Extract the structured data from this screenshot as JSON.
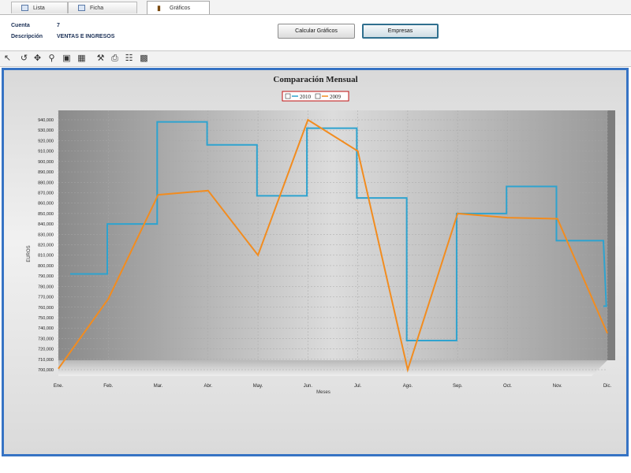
{
  "tabs": [
    {
      "label": "Lista"
    },
    {
      "label": "Ficha"
    },
    {
      "label": "Gráficos"
    }
  ],
  "info": {
    "cuenta_label": "Cuenta",
    "cuenta_value": "7",
    "descripcion_label": "Descripción",
    "descripcion_value": "VENTAS E INGRESOS"
  },
  "buttons": {
    "calcular": "Calcular Gráficos",
    "empresas": "Empresas"
  },
  "toolbar_icons": [
    "pointer-icon",
    "rotate-icon",
    "move-icon",
    "zoom-icon",
    "copy-icon",
    "export-icon",
    "settings-icon",
    "print-icon",
    "clipboard-icon",
    "save-icon"
  ],
  "colors": {
    "series_2010": "#2ea3cf",
    "series_2009": "#f28c1f",
    "panel_border": "#3673c4"
  },
  "chart_data": {
    "type": "line",
    "title": "Comparación Mensual",
    "xlabel": "Meses",
    "ylabel": "EUROS",
    "categories": [
      "Ene.",
      "Feb.",
      "Mar.",
      "Abr.",
      "May.",
      "Jun.",
      "Jul.",
      "Ago.",
      "Sep.",
      "Oct.",
      "Nov.",
      "Dic."
    ],
    "ylim": [
      700000,
      940000
    ],
    "yticks": [
      "940,000",
      "930,000",
      "920,000",
      "910,000",
      "900,000",
      "890,000",
      "880,000",
      "870,000",
      "860,000",
      "850,000",
      "840,000",
      "830,000",
      "820,000",
      "810,000",
      "800,000",
      "790,000",
      "780,000",
      "770,000",
      "760,000",
      "750,000",
      "740,000",
      "730,000",
      "720,000",
      "710,000",
      "700,000"
    ],
    "grid": true,
    "legend_position": "top-center",
    "series": [
      {
        "name": "2010",
        "style": "step",
        "values": [
          792000,
          840000,
          938000,
          916000,
          867000,
          932000,
          865000,
          728000,
          850000,
          876000,
          824000,
          761000
        ]
      },
      {
        "name": "2009",
        "style": "line",
        "values": [
          701000,
          768000,
          868000,
          872000,
          810000,
          940000,
          910000,
          700000,
          850000,
          846000,
          845000,
          735000
        ]
      }
    ]
  }
}
